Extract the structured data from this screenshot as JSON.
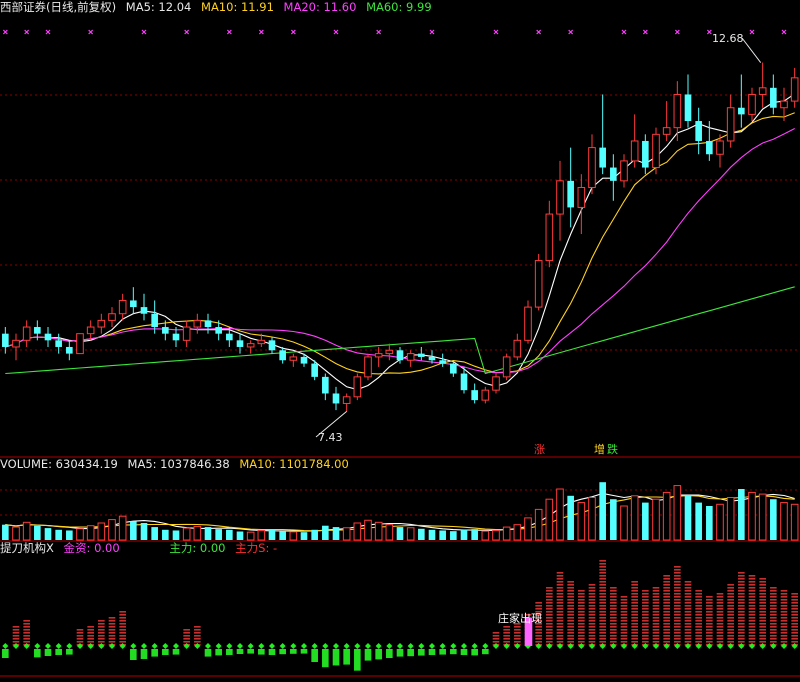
{
  "main": {
    "title": "西部证券(日线,前复权)",
    "ma5_label": "MA5: 12.04",
    "ma10_label": "MA10: 11.91",
    "ma20_label": "MA20: 11.60",
    "ma60_label": "MA60: 9.99",
    "high_marker": "12.68",
    "low_marker": "7.43",
    "tag_zhangting": "涨",
    "tag_zeng": "增",
    "tag_die": "跌"
  },
  "volume": {
    "volume_label": "VOLUME: 630434.19",
    "ma5_label": "MA5: 1037846.38",
    "ma10_label": "MA10: 1101784.00"
  },
  "indicator": {
    "name_label": "提刀机构X",
    "jinzi_label": "金资: 0.00",
    "zhuli_label": "主力: 0.00",
    "zhuli_s_label": "主力S: -",
    "zhuangjia_label": "庄家出现"
  },
  "colors": {
    "background": "#000000",
    "up_candle": "#ff3c3c",
    "down_candle": "#54ffff",
    "ma5": "#ffffff",
    "ma10": "#ffd21f",
    "ma20": "#ff40ff",
    "ma60": "#3ce63c",
    "grid": "#8b0000"
  },
  "chart_data": {
    "type": "candlestick",
    "price_range": [
      7.0,
      13.2
    ],
    "volume_range": [
      0,
      2000000
    ],
    "candles": [
      [
        8.6,
        8.7,
        8.3,
        8.4
      ],
      [
        8.4,
        8.6,
        8.2,
        8.5
      ],
      [
        8.5,
        8.8,
        8.4,
        8.7
      ],
      [
        8.7,
        8.8,
        8.5,
        8.6
      ],
      [
        8.6,
        8.7,
        8.4,
        8.5
      ],
      [
        8.5,
        8.6,
        8.3,
        8.4
      ],
      [
        8.4,
        8.5,
        8.2,
        8.3
      ],
      [
        8.3,
        8.6,
        8.3,
        8.6
      ],
      [
        8.6,
        8.8,
        8.5,
        8.7
      ],
      [
        8.7,
        8.9,
        8.6,
        8.8
      ],
      [
        8.8,
        9.0,
        8.7,
        8.9
      ],
      [
        8.9,
        9.2,
        8.8,
        9.1
      ],
      [
        9.1,
        9.3,
        8.9,
        9.0
      ],
      [
        9.0,
        9.2,
        8.8,
        8.9
      ],
      [
        8.9,
        9.1,
        8.6,
        8.7
      ],
      [
        8.7,
        8.8,
        8.5,
        8.6
      ],
      [
        8.6,
        8.7,
        8.4,
        8.5
      ],
      [
        8.5,
        8.8,
        8.4,
        8.7
      ],
      [
        8.7,
        8.9,
        8.6,
        8.8
      ],
      [
        8.8,
        8.9,
        8.6,
        8.7
      ],
      [
        8.7,
        8.8,
        8.5,
        8.6
      ],
      [
        8.6,
        8.7,
        8.4,
        8.5
      ],
      [
        8.5,
        8.6,
        8.3,
        8.4
      ],
      [
        8.4,
        8.5,
        8.3,
        8.45
      ],
      [
        8.45,
        8.6,
        8.4,
        8.5
      ],
      [
        8.5,
        8.55,
        8.3,
        8.35
      ],
      [
        8.35,
        8.4,
        8.15,
        8.2
      ],
      [
        8.2,
        8.3,
        8.1,
        8.25
      ],
      [
        8.25,
        8.3,
        8.1,
        8.15
      ],
      [
        8.15,
        8.2,
        7.9,
        7.95
      ],
      [
        7.95,
        8.0,
        7.6,
        7.7
      ],
      [
        7.7,
        7.8,
        7.45,
        7.55
      ],
      [
        7.55,
        7.7,
        7.43,
        7.65
      ],
      [
        7.65,
        8.0,
        7.6,
        7.95
      ],
      [
        7.95,
        8.3,
        7.9,
        8.25
      ],
      [
        8.25,
        8.4,
        8.1,
        8.3
      ],
      [
        8.3,
        8.45,
        8.2,
        8.35
      ],
      [
        8.35,
        8.4,
        8.15,
        8.2
      ],
      [
        8.2,
        8.35,
        8.1,
        8.3
      ],
      [
        8.3,
        8.4,
        8.2,
        8.25
      ],
      [
        8.25,
        8.35,
        8.15,
        8.2
      ],
      [
        8.2,
        8.3,
        8.1,
        8.15
      ],
      [
        8.15,
        8.2,
        7.95,
        8.0
      ],
      [
        8.0,
        8.1,
        7.7,
        7.75
      ],
      [
        7.75,
        7.85,
        7.55,
        7.6
      ],
      [
        7.6,
        7.8,
        7.55,
        7.75
      ],
      [
        7.75,
        8.0,
        7.7,
        7.95
      ],
      [
        7.95,
        8.3,
        7.9,
        8.25
      ],
      [
        8.25,
        8.6,
        8.2,
        8.5
      ],
      [
        8.5,
        9.1,
        8.45,
        9.0
      ],
      [
        9.0,
        9.8,
        8.95,
        9.7
      ],
      [
        9.7,
        10.6,
        9.6,
        10.4
      ],
      [
        10.4,
        11.2,
        10.0,
        10.9
      ],
      [
        10.9,
        11.4,
        10.2,
        10.5
      ],
      [
        10.5,
        11.0,
        10.1,
        10.8
      ],
      [
        10.8,
        11.6,
        10.7,
        11.4
      ],
      [
        11.4,
        12.2,
        11.0,
        11.1
      ],
      [
        11.1,
        11.3,
        10.6,
        10.9
      ],
      [
        10.9,
        11.3,
        10.8,
        11.2
      ],
      [
        11.2,
        11.9,
        11.1,
        11.5
      ],
      [
        11.5,
        11.6,
        11.0,
        11.1
      ],
      [
        11.1,
        11.7,
        11.0,
        11.6
      ],
      [
        11.6,
        12.1,
        11.5,
        11.7
      ],
      [
        11.7,
        12.4,
        11.5,
        12.2
      ],
      [
        12.2,
        12.5,
        11.7,
        11.8
      ],
      [
        11.8,
        12.0,
        11.3,
        11.5
      ],
      [
        11.5,
        11.8,
        11.2,
        11.3
      ],
      [
        11.3,
        11.6,
        11.1,
        11.5
      ],
      [
        11.5,
        12.2,
        11.4,
        12.0
      ],
      [
        12.0,
        12.5,
        11.7,
        11.9
      ],
      [
        11.9,
        12.3,
        11.8,
        12.2
      ],
      [
        12.2,
        12.68,
        12.0,
        12.3
      ],
      [
        12.3,
        12.5,
        11.9,
        12.0
      ],
      [
        12.0,
        12.3,
        11.8,
        12.1
      ],
      [
        12.1,
        12.6,
        12.0,
        12.45
      ]
    ],
    "volumes": [
      450000,
      380000,
      520000,
      420000,
      350000,
      300000,
      280000,
      330000,
      420000,
      500000,
      600000,
      700000,
      550000,
      500000,
      380000,
      300000,
      280000,
      350000,
      400000,
      380000,
      320000,
      300000,
      250000,
      230000,
      280000,
      300000,
      260000,
      240000,
      230000,
      300000,
      420000,
      380000,
      360000,
      500000,
      580000,
      520000,
      450000,
      380000,
      360000,
      330000,
      300000,
      280000,
      260000,
      300000,
      320000,
      260000,
      280000,
      380000,
      450000,
      650000,
      900000,
      1200000,
      1500000,
      1300000,
      1100000,
      1250000,
      1700000,
      1200000,
      1000000,
      1300000,
      1100000,
      1200000,
      1400000,
      1600000,
      1300000,
      1100000,
      1000000,
      1050000,
      1250000,
      1500000,
      1400000,
      1350000,
      1200000,
      1100000,
      1050000
    ],
    "price_labels": {
      "high": "12.68",
      "low": "7.43"
    }
  }
}
